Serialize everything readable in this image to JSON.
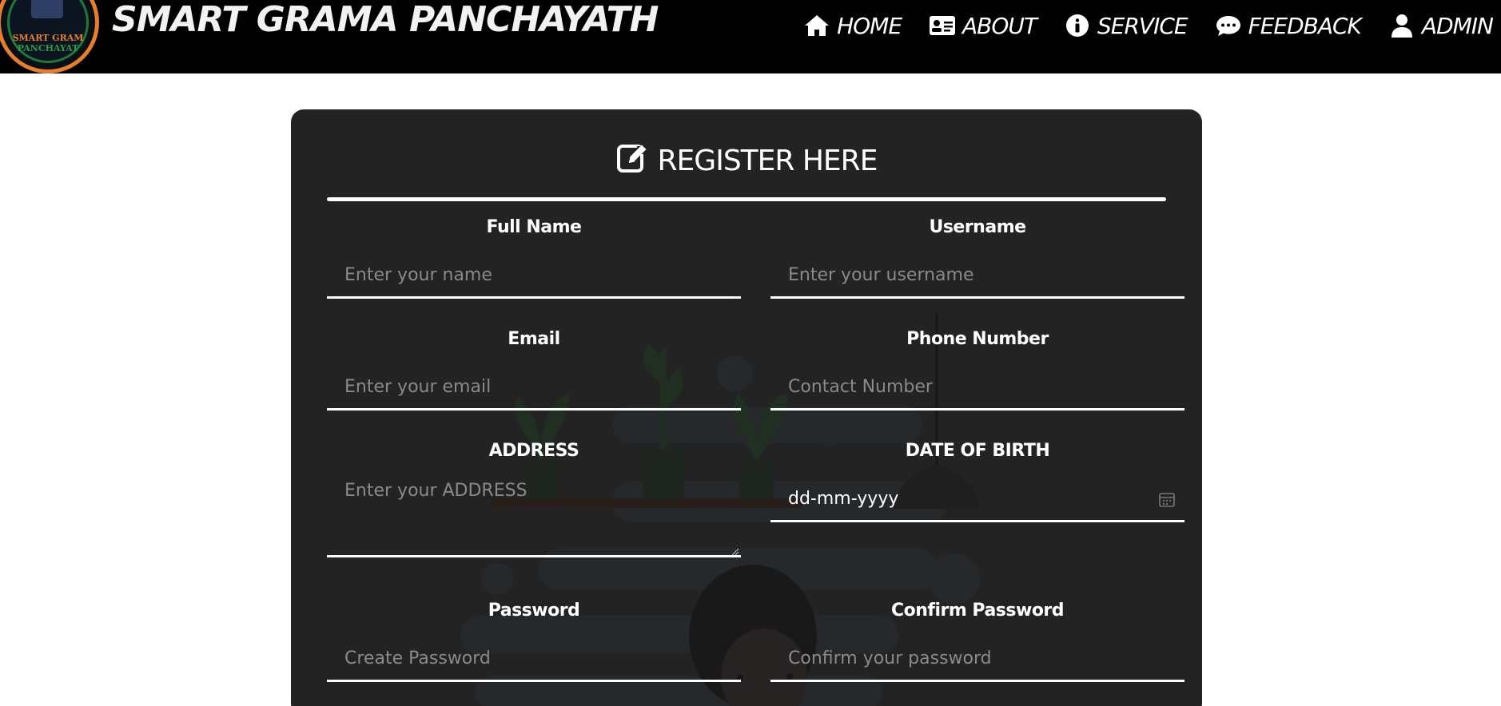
{
  "header": {
    "logo_text_line1": "SMART GRAM",
    "logo_text_line2": "PANCHAYAT",
    "brand_title": "SMART GRAMA PANCHAYATH",
    "nav": [
      {
        "label": "HOME",
        "icon": "home-icon"
      },
      {
        "label": "ABOUT",
        "icon": "id-card-icon"
      },
      {
        "label": "SERVICE",
        "icon": "info-icon"
      },
      {
        "label": "FEEDBACK",
        "icon": "comment-icon"
      },
      {
        "label": "ADMIN",
        "icon": "user-icon"
      }
    ]
  },
  "form": {
    "title": "REGISTER HERE",
    "title_icon": "edit-icon",
    "fields": {
      "full_name": {
        "label": "Full Name",
        "placeholder": "Enter your name"
      },
      "username": {
        "label": "Username",
        "placeholder": "Enter your username"
      },
      "email": {
        "label": "Email",
        "placeholder": "Enter your email"
      },
      "phone": {
        "label": "Phone Number",
        "placeholder": "Contact Number"
      },
      "address": {
        "label": "ADDRESS",
        "placeholder": "Enter your ADDRESS"
      },
      "dob": {
        "label": "DATE OF BIRTH",
        "value": "dd-mm-yyyy"
      },
      "password": {
        "label": "Password",
        "placeholder": "Create Password"
      },
      "confirm_password": {
        "label": "Confirm Password",
        "placeholder": "Confirm your password"
      }
    }
  },
  "colors": {
    "navbar_bg": "#000000",
    "card_bg": "#232323",
    "logo_ring": "#e77e2c",
    "text_primary": "#ffffff",
    "placeholder": "#8a8a8a"
  }
}
